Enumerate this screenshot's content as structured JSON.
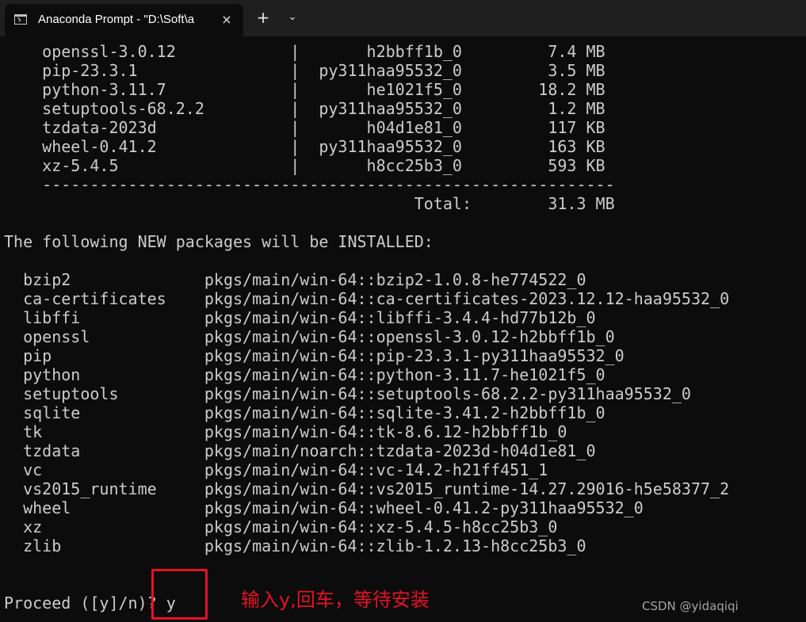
{
  "tab": {
    "title": "Anaconda Prompt - \"D:\\Soft\\a",
    "icon": "terminal-icon",
    "close_icon": "×",
    "new_tab_icon": "+",
    "dropdown_icon": "⌄"
  },
  "terminal": {
    "lines": [
      "    openssl-3.0.12            |       h2bbff1b_0         7.4 MB",
      "    pip-23.3.1                |  py311haa95532_0         3.5 MB",
      "    python-3.11.7             |       he1021f5_0        18.2 MB",
      "    setuptools-68.2.2         |  py311haa95532_0         1.2 MB",
      "    tzdata-2023d              |       h04d1e81_0         117 KB",
      "    wheel-0.41.2              |  py311haa95532_0         163 KB",
      "    xz-5.4.5                  |       h8cc25b3_0         593 KB",
      "    ------------------------------------------------------------",
      "                                           Total:        31.3 MB",
      "",
      "The following NEW packages will be INSTALLED:",
      "",
      "  bzip2              pkgs/main/win-64::bzip2-1.0.8-he774522_0",
      "  ca-certificates    pkgs/main/win-64::ca-certificates-2023.12.12-haa95532_0",
      "  libffi             pkgs/main/win-64::libffi-3.4.4-hd77b12b_0",
      "  openssl            pkgs/main/win-64::openssl-3.0.12-h2bbff1b_0",
      "  pip                pkgs/main/win-64::pip-23.3.1-py311haa95532_0",
      "  python             pkgs/main/win-64::python-3.11.7-he1021f5_0",
      "  setuptools         pkgs/main/win-64::setuptools-68.2.2-py311haa95532_0",
      "  sqlite             pkgs/main/win-64::sqlite-3.41.2-h2bbff1b_0",
      "  tk                 pkgs/main/win-64::tk-8.6.12-h2bbff1b_0",
      "  tzdata             pkgs/main/noarch::tzdata-2023d-h04d1e81_0",
      "  vc                 pkgs/main/win-64::vc-14.2-h21ff451_1",
      "  vs2015_runtime     pkgs/main/win-64::vs2015_runtime-14.27.29016-h5e58377_2",
      "  wheel              pkgs/main/win-64::wheel-0.41.2-py311haa95532_0",
      "  xz                 pkgs/main/win-64::xz-5.4.5-h8cc25b3_0",
      "  zlib               pkgs/main/win-64::zlib-1.2.13-h8cc25b3_0",
      "",
      "",
      "Proceed ([y]/n)? y"
    ]
  },
  "annotation": {
    "text": "输入y,回车，等待安装"
  },
  "watermark": {
    "text": "CSDN @yidaqiqi"
  },
  "colors": {
    "background": "#0c0c0c",
    "terminal_text": "#cccccc",
    "highlight_red": "#e81123",
    "tab_bar": "#1f1f1f"
  }
}
